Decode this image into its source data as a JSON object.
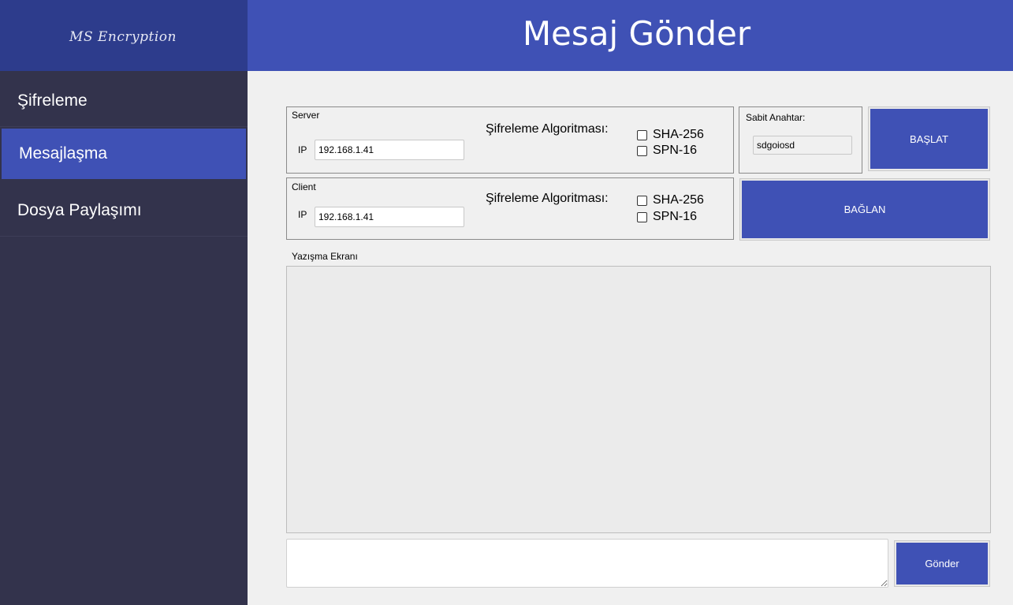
{
  "sidebar": {
    "logo": "MS Encryption",
    "items": [
      {
        "label": "Şifreleme"
      },
      {
        "label": "Mesajlaşma"
      },
      {
        "label": "Dosya Paylaşımı"
      }
    ]
  },
  "header": {
    "title": "Mesaj Gönder"
  },
  "server": {
    "label": "Server",
    "ip_label": "IP",
    "ip_value": "192.168.1.41",
    "algorithm_label": "Şifreleme Algoritması:",
    "options": [
      "SHA-256",
      "SPN-16"
    ]
  },
  "client": {
    "label": "Client",
    "ip_label": "IP",
    "ip_value": "192.168.1.41",
    "algorithm_label": "Şifreleme Algoritması:",
    "options": [
      "SHA-256",
      "SPN-16"
    ]
  },
  "key": {
    "label": "Sabit Anahtar:",
    "value": "sdgoiosd"
  },
  "buttons": {
    "start": "BAŞLAT",
    "connect": "BAĞLAN",
    "send": "Gönder"
  },
  "chat": {
    "label": "Yazışma Ekranı",
    "message_value": ""
  },
  "colors": {
    "accent": "#3f51b5",
    "sidebar_bg": "#33334c",
    "logo_bg": "#2d3c8c"
  }
}
